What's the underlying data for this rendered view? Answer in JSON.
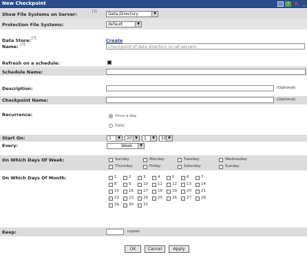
{
  "title": "New Checkpoint",
  "window_controls": {
    "restore": "▭",
    "help": "?",
    "close": "×",
    "minimize": "_"
  },
  "fields": {
    "show_label": "Show File Systems on Server:",
    "show_sup": "[?]",
    "show_value": "Data Directory",
    "protection_label": "Protection File Systems:",
    "protection_value": "default",
    "data_store_label": "Data Store:",
    "data_store_sup": "[?]",
    "data_store_link": "Create",
    "name_label": "Name:",
    "name_sup": "[?]",
    "name_value": "Checkpoint of data directory on all servers",
    "refresh_label": "Refresh on a schedule:",
    "refresh_checked": true,
    "schedule_name_label": "Schedule Name:",
    "schedule_name_value": "",
    "description_label": "Description:",
    "description_value": "",
    "description_opt": "(Optional)",
    "checkpoint_name_label": "Checkpoint Name:",
    "checkpoint_name_value": "",
    "checkpoint_name_opt": "(Optional)",
    "recurrence_label": "Recurrence:",
    "recurrence_options": [
      "Once a day",
      "Daily"
    ],
    "start_on_label": "Start On:",
    "start_on_values": [
      "1",
      "2013",
      "1",
      "10"
    ],
    "every_label": "Every:",
    "every_value": "Week",
    "days_of_week_label": "On Which Days Of Week:",
    "days_of_week": [
      "Sunday",
      "Monday",
      "Tuesday",
      "Wednesday",
      "Thursday",
      "Friday",
      "Saturday",
      "Sunday"
    ],
    "days_of_month_label": "On Which Days Of Month:",
    "days_of_month": [
      "1",
      "2",
      "3",
      "4",
      "5",
      "6",
      "7",
      "8",
      "9",
      "10",
      "11",
      "12",
      "13",
      "14",
      "15",
      "16",
      "17",
      "18",
      "19",
      "20",
      "21",
      "22",
      "23",
      "24",
      "25",
      "26",
      "27",
      "28",
      "29",
      "30",
      "31"
    ],
    "keep_label": "Keep:",
    "keep_value": "",
    "keep_unit": "copies"
  },
  "buttons": {
    "ok": "OK",
    "cancel": "Cancel",
    "apply": "Apply"
  }
}
